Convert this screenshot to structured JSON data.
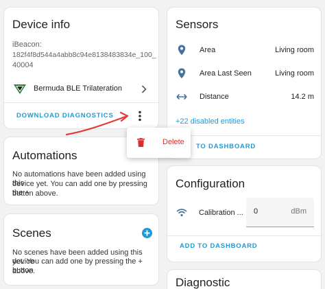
{
  "device_info": {
    "title": "Device info",
    "ibeacon_label": "iBeacon:",
    "ibeacon_id_line1": "182f4f8d544a4abb8c94e8138483834e_100_",
    "ibeacon_id_line2": "40004",
    "integration_name": "Bermuda BLE Trilateration",
    "download_diagnostics": "DOWNLOAD DIAGNOSTICS"
  },
  "menu": {
    "delete_label": "Delete"
  },
  "automations": {
    "title": "Automations",
    "empty_text_line1": "No automations have been added using this",
    "empty_text_line2": "device yet. You can add one by pressing the +",
    "empty_text_line3": "button above."
  },
  "scenes": {
    "title": "Scenes",
    "empty_text_line1": "No scenes have been added using this device",
    "empty_text_line2": "yet. You can add one by pressing the + button",
    "empty_text_line3": "above."
  },
  "sensors": {
    "title": "Sensors",
    "rows": [
      {
        "label": "Area",
        "value": "Living room",
        "icon": "map-marker-icon"
      },
      {
        "label": "Area Last Seen",
        "value": "Living room",
        "icon": "map-marker-icon"
      },
      {
        "label": "Distance",
        "value": "14.2 m",
        "icon": "arrow-left-right-icon"
      }
    ],
    "disabled_entities": "+22 disabled entities",
    "add_to_dashboard": "ADD TO DASHBOARD",
    "add_to_dashboard_partial": "TO DASHBOARD"
  },
  "configuration": {
    "title": "Configuration",
    "calibration_label": "Calibration ...",
    "calibration_value": "0",
    "calibration_unit": "dBm",
    "add_to_dashboard": "ADD TO DASHBOARD"
  },
  "diagnostic": {
    "title": "Diagnostic"
  },
  "colors": {
    "accent": "#1e9ad6",
    "delete": "#d8302e",
    "annotation_arrow": "#e53935",
    "icon": "#44739e"
  }
}
